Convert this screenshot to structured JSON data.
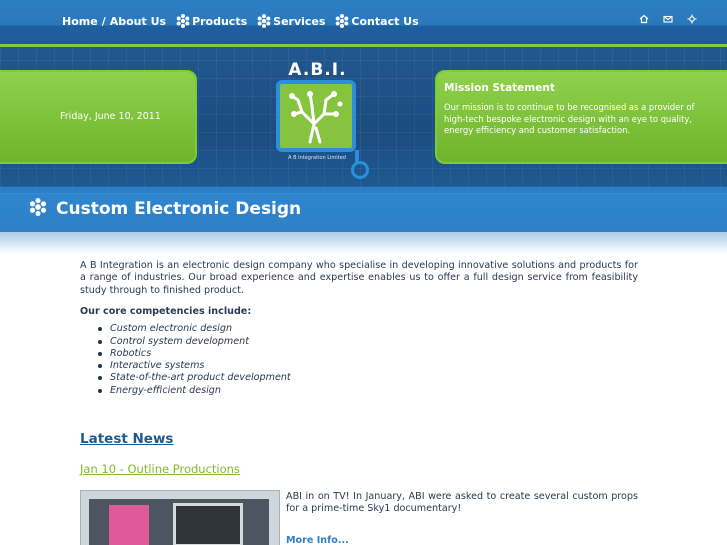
{
  "nav": {
    "home": "Home",
    "separator": "/",
    "about": "About Us",
    "products": "Products",
    "services": "Services",
    "contact": "Contact Us"
  },
  "toolbar_icons": [
    "home-icon",
    "mail-icon",
    "sitemap-icon"
  ],
  "banner": {
    "date": "Friday, June 10, 2011",
    "logo_title": "A.B.I.",
    "logo_subtitle": "A B Integration Limited",
    "mission_title": "Mission Statement",
    "mission_text": "Our mission is to continue to be recognised as a provider of high-tech bespoke electronic design with an eye to quality, energy efficiency and customer satisfaction."
  },
  "page": {
    "title": "Custom Electronic Design"
  },
  "content": {
    "intro": "A B Integration is an electronic design company who specialise in developing innovative solutions and products for a range of industries. Our broad experience and expertise enables us to offer a full design service from feasibility study through to finished product.",
    "core_heading": "Our core competencies include:",
    "competencies": [
      "Custom electronic design",
      "Control system development",
      "Robotics",
      "Interactive systems",
      "State-of-the-art product development",
      "Energy-efficient design"
    ]
  },
  "news": {
    "heading": "Latest News",
    "item_title": "Jan 10 - Outline Productions",
    "item_text": "ABI in on TV! In January, ABI were asked to create several custom props for a prime-time Sky1 documentary!",
    "more": "More Info..."
  },
  "colors": {
    "nav_blue": "#2c7fc2",
    "accent_green": "#8dc63f",
    "banner_dark": "#1c4c80",
    "text": "#2b3a52",
    "link_blue": "#2e7fc7"
  }
}
